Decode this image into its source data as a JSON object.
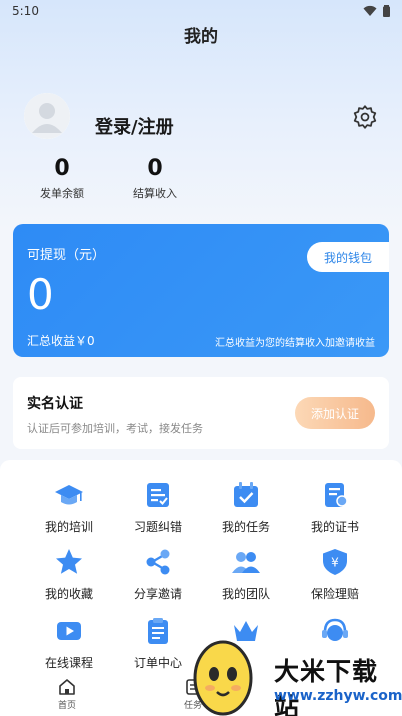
{
  "status_bar": {
    "time": "5:10"
  },
  "page": {
    "title": "我的"
  },
  "profile": {
    "login_label": "登录/注册"
  },
  "stats": [
    {
      "value": "0",
      "label": "发单余额"
    },
    {
      "value": "0",
      "label": "结算收入"
    }
  ],
  "wallet": {
    "withdrawable_label": "可提现（元）",
    "withdrawable_value": "0",
    "my_wallet_button": "我的钱包",
    "total_income": "汇总收益￥0",
    "note": "汇总收益为您的结算收入加邀请收益"
  },
  "verify": {
    "title": "实名认证",
    "desc": "认证后可参加培训，考试，接发任务",
    "button": "添加认证"
  },
  "grid": [
    {
      "label": "我的培训",
      "icon": "graduation-cap-icon"
    },
    {
      "label": "习题纠错",
      "icon": "exercise-correction-icon"
    },
    {
      "label": "我的任务",
      "icon": "task-icon"
    },
    {
      "label": "我的证书",
      "icon": "certificate-icon"
    },
    {
      "label": "我的收藏",
      "icon": "star-icon"
    },
    {
      "label": "分享邀请",
      "icon": "share-icon"
    },
    {
      "label": "我的团队",
      "icon": "team-icon"
    },
    {
      "label": "保险理赔",
      "icon": "insurance-shield-icon"
    },
    {
      "label": "在线课程",
      "icon": "video-course-icon"
    },
    {
      "label": "订单中心",
      "icon": "order-clipboard-icon"
    },
    {
      "label": "",
      "icon": "crown-icon"
    },
    {
      "label": "",
      "icon": "customer-service-icon"
    }
  ],
  "tabbar": [
    {
      "label": "首页",
      "icon": "home-icon"
    },
    {
      "label": "任务",
      "icon": "task-tab-icon"
    }
  ],
  "watermark": {
    "title": "大米下载站",
    "url": "www.zzhyw.com"
  },
  "colors": {
    "primary": "#2e8bf5",
    "accent_orange": "#f6b98c",
    "background": "#f3f6fb"
  }
}
